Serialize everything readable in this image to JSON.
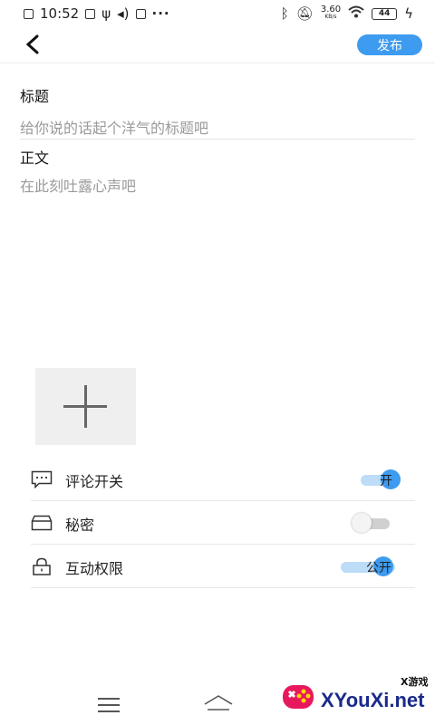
{
  "status_bar": {
    "time": "10:52",
    "speed_value": "3.60",
    "speed_unit": "KB/s",
    "battery": "44"
  },
  "header": {
    "publish_label": "发布"
  },
  "form": {
    "title_label": "标题",
    "title_placeholder": "给你说的话起个洋气的标题吧",
    "body_label": "正文",
    "body_placeholder": "在此刻吐露心声吧"
  },
  "settings": {
    "comment": {
      "label": "评论开关",
      "toggle_text": "开",
      "on": true
    },
    "secret": {
      "label": "秘密",
      "on": false
    },
    "interact": {
      "label": "互动权限",
      "toggle_text": "公开",
      "on": true
    }
  },
  "colors": {
    "accent": "#3d9bf0",
    "track_on": "#bcdcf7",
    "track_off": "#d0d0d0"
  },
  "watermark": {
    "small": "X游戏",
    "big": "XYouXi.net"
  }
}
